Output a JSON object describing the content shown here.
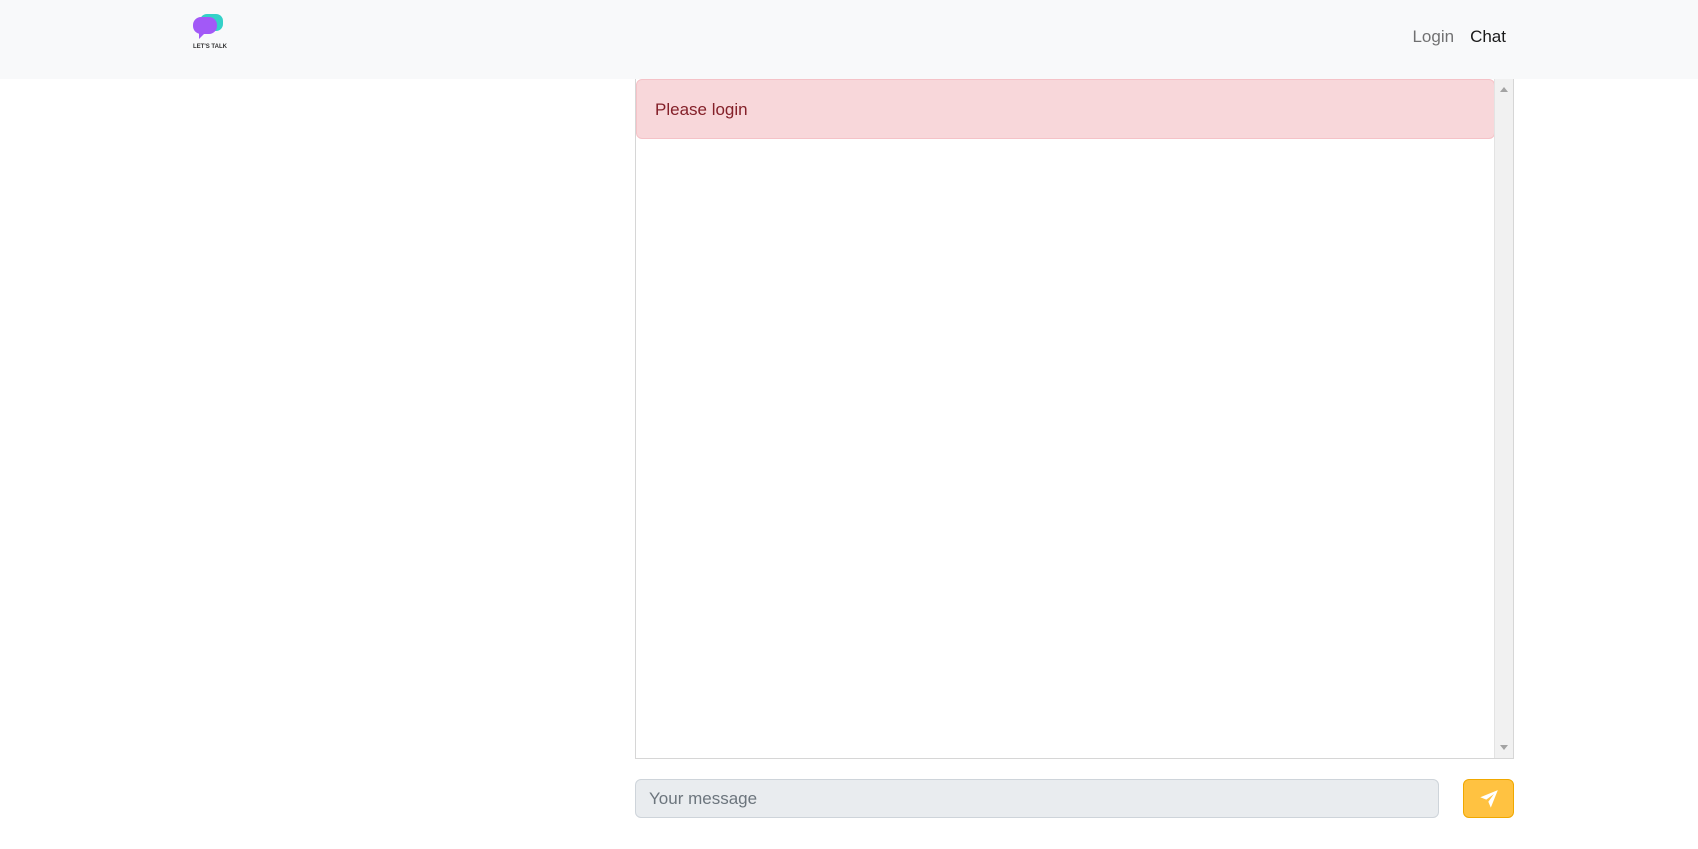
{
  "navbar": {
    "logo": {
      "text": "LET'S TALK",
      "icon": "chat-bubbles-logo"
    },
    "links": [
      {
        "label": "Login",
        "active": false
      },
      {
        "label": "Chat",
        "active": true
      }
    ]
  },
  "chat": {
    "alert_text": "Please login",
    "input_placeholder": "Your message",
    "input_value": "",
    "send_icon": "paper-plane-icon"
  },
  "colors": {
    "navbar_bg": "#f8f9fa",
    "alert_bg": "#f8d7da",
    "alert_text": "#842029",
    "send_button": "#ffc241",
    "logo_purple": "#a259f7",
    "logo_teal": "#34d1c8"
  }
}
